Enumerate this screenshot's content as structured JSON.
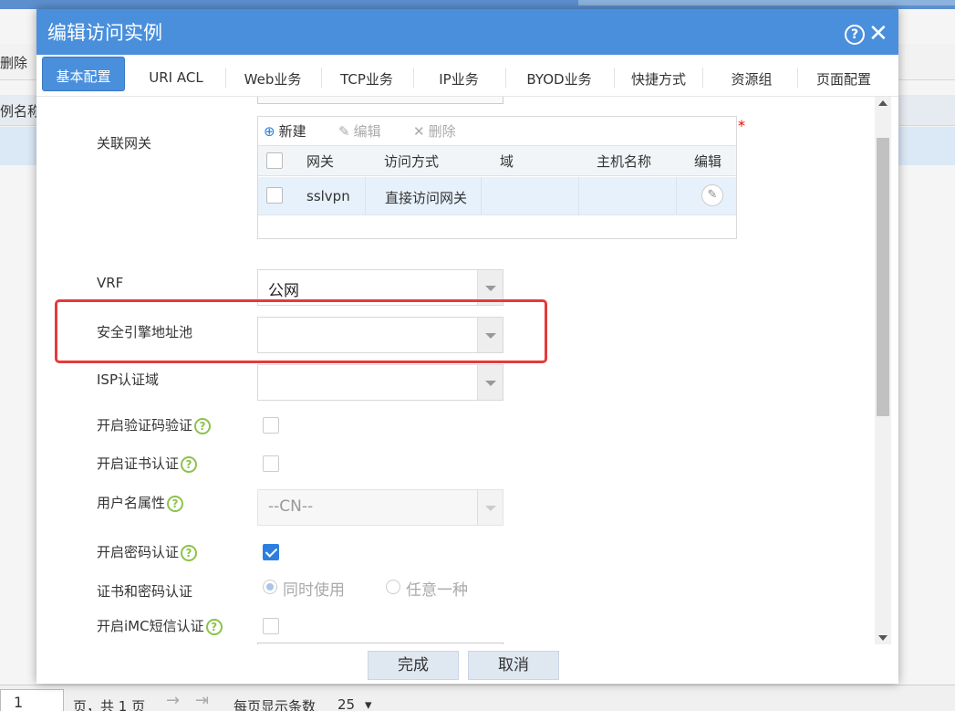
{
  "background": {
    "toolbar_delete": "删除",
    "column_header": "例名称",
    "pager": {
      "current_page": "1",
      "page_text": "页，共 1 页",
      "per_page_label": "每页显示条数",
      "per_page_value": "25",
      "dropdown_glyph": "▾",
      "next_glyph": "→",
      "last_glyph": "⇥"
    }
  },
  "dialog": {
    "title": "编辑访问实例",
    "help_glyph": "?",
    "close_glyph": "✕",
    "tabs": [
      {
        "label": "基本配置",
        "active": true
      },
      {
        "label": "URI ACL"
      },
      {
        "label": "Web业务"
      },
      {
        "label": "TCP业务"
      },
      {
        "label": "IP业务"
      },
      {
        "label": "BYOD业务"
      },
      {
        "label": "快捷方式"
      },
      {
        "label": "资源组"
      },
      {
        "label": "页面配置"
      }
    ],
    "gateway": {
      "label": "关联网关",
      "required_mark": "*",
      "toolbar": {
        "new_icon": "⊕",
        "new": "新建",
        "edit_icon": "✎",
        "edit": "编辑",
        "delete_icon": "✕",
        "delete": "删除"
      },
      "columns": [
        "网关",
        "访问方式",
        "域",
        "主机名称",
        "编辑"
      ],
      "rows": [
        {
          "gateway": "sslvpn",
          "access": "直接访问网关",
          "domain": "",
          "host": "",
          "edit_icon": "✎"
        }
      ]
    },
    "fields": {
      "vrf": {
        "label": "VRF",
        "value": "公网"
      },
      "sec_pool": {
        "label": "安全引擎地址池",
        "value": ""
      },
      "isp": {
        "label": "ISP认证域",
        "value": ""
      },
      "captcha": {
        "label": "开启验证码验证",
        "checked": false
      },
      "cert": {
        "label": "开启证书认证",
        "checked": false
      },
      "username_attr": {
        "label": "用户名属性",
        "value": "--CN--"
      },
      "password": {
        "label": "开启密码认证",
        "checked": true
      },
      "cert_pwd": {
        "label": "证书和密码认证",
        "opt1": "同时使用",
        "opt2": "任意一种"
      },
      "imc_sms": {
        "label": "开启iMC短信认证",
        "checked": false
      }
    },
    "q_glyph": "?",
    "footer": {
      "ok": "完成",
      "cancel": "取消"
    }
  },
  "colors": {
    "title_bg": "#4a8fdc",
    "highlight": "#e53a3a",
    "checkbox_checked": "#2a7fe0",
    "help_icon": "#8cc34a"
  }
}
